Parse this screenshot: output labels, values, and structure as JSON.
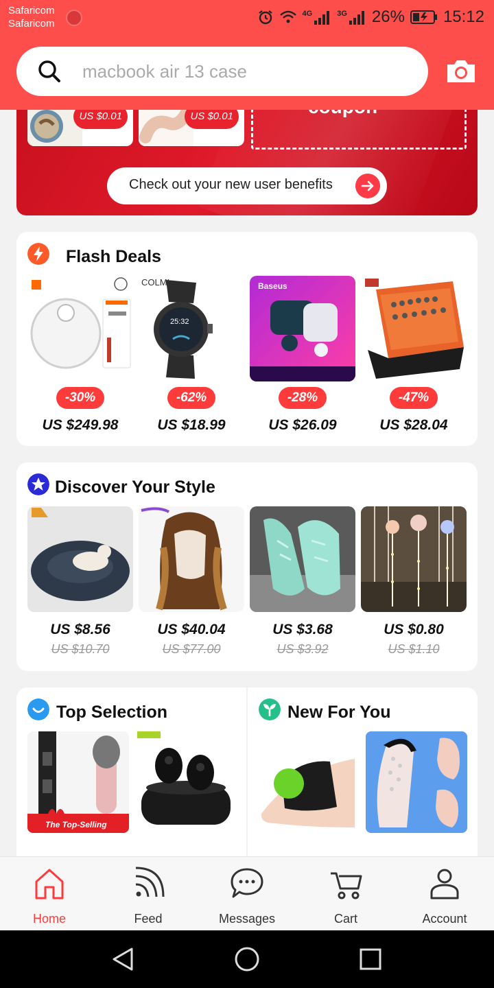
{
  "status_bar": {
    "carrier_line1": "Safaricom",
    "carrier_line2": "Safaricom",
    "net1": "4G",
    "net2": "3G",
    "battery": "26%",
    "time": "15:12"
  },
  "search": {
    "placeholder": "macbook air 13 case",
    "icon": "search-icon",
    "camera_icon": "camera-icon"
  },
  "banner": {
    "mini_prices": [
      "US $0.01",
      "US $0.01"
    ],
    "coupon_text": "coupon",
    "cta_label": "Check out your new user benefits"
  },
  "flash_deals": {
    "title": "Flash Deals",
    "items": [
      {
        "brand": "",
        "discount": "-30%",
        "price": "US $249.98"
      },
      {
        "brand": "COLMI",
        "discount": "-62%",
        "price": "US $18.99"
      },
      {
        "brand": "Baseus",
        "discount": "-28%",
        "price": "US $26.09"
      },
      {
        "brand": "",
        "discount": "-47%",
        "price": "US $28.04"
      }
    ]
  },
  "discover": {
    "title": "Discover Your Style",
    "items": [
      {
        "price": "US $8.56",
        "old_price": "US $10.70"
      },
      {
        "price": "US $40.04",
        "old_price": "US $77.00"
      },
      {
        "price": "US $3.68",
        "old_price": "US $3.92"
      },
      {
        "price": "US $0.80",
        "old_price": "US $1.10"
      }
    ]
  },
  "top_selection": {
    "title": "Top Selection",
    "ribbon": "The Top-Selling"
  },
  "new_for_you": {
    "title": "New For You"
  },
  "bottom_nav": {
    "items": [
      {
        "label": "Home",
        "icon": "home-icon",
        "active": true
      },
      {
        "label": "Feed",
        "icon": "feed-icon",
        "active": false
      },
      {
        "label": "Messages",
        "icon": "messages-icon",
        "active": false
      },
      {
        "label": "Cart",
        "icon": "cart-icon",
        "active": false
      },
      {
        "label": "Account",
        "icon": "account-icon",
        "active": false
      }
    ]
  },
  "colors": {
    "brand_red": "#fd4e4b",
    "badge_red": "#fd3b3b",
    "active_tab": "#fd3b3b"
  }
}
